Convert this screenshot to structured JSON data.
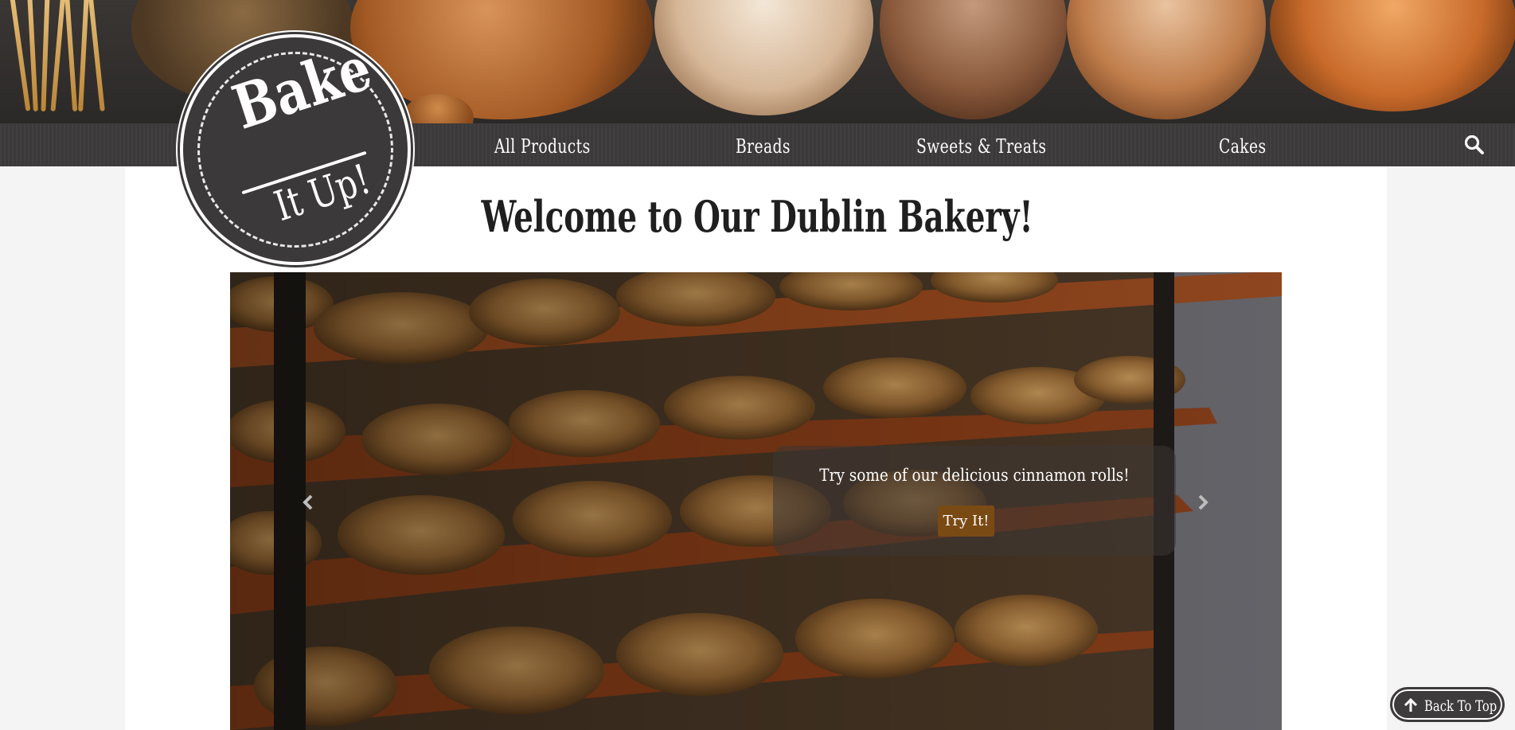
{
  "brand": {
    "logo_line1": "Bake",
    "logo_line2": "It Up!"
  },
  "nav": {
    "items": [
      {
        "label": "All Products"
      },
      {
        "label": "Breads"
      },
      {
        "label": "Sweets & Treats"
      },
      {
        "label": "Cakes"
      }
    ],
    "search_icon": "search-icon"
  },
  "main": {
    "title": "Welcome to Our Dublin Bakery!"
  },
  "carousel": {
    "caption": "Try some of our delicious cinnamon rolls!",
    "button_label": "Try It!",
    "prev_icon": "chevron-left-icon",
    "next_icon": "chevron-right-icon"
  },
  "back_to_top": {
    "label": "Back To Top",
    "icon": "arrow-up-icon"
  },
  "colors": {
    "nav_bg": "#3d3b3b",
    "button_brown": "#7a4a14",
    "page_bg": "#f4f4f4"
  }
}
